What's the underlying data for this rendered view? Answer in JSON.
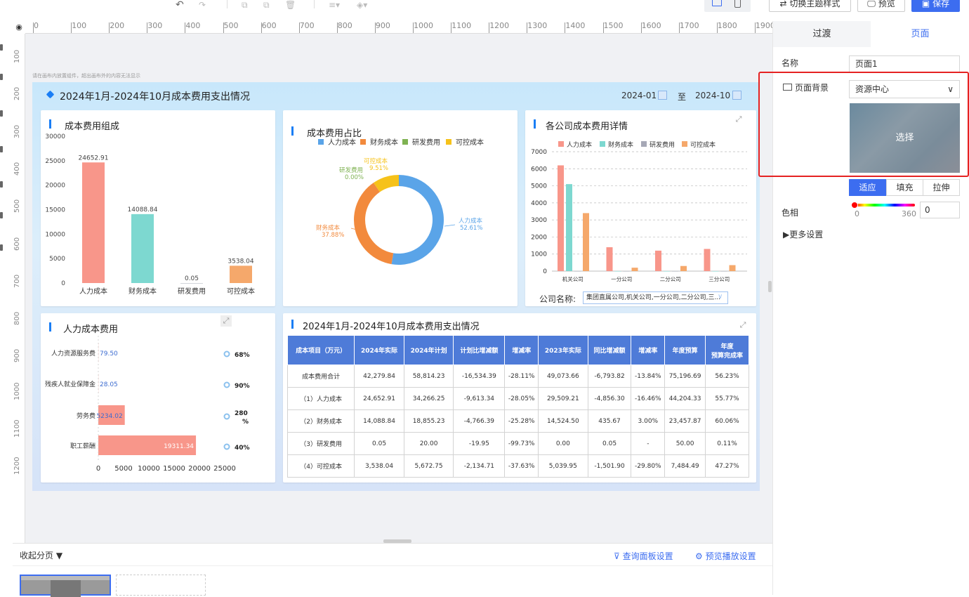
{
  "toolbar": {
    "switch_theme": "切换主题样式",
    "preview": "预览",
    "save": "保存"
  },
  "ruler": {
    "h": [
      "0",
      "100",
      "200",
      "300",
      "400",
      "500",
      "600",
      "700",
      "800",
      "900",
      "1000",
      "1100",
      "1200",
      "1300",
      "1400",
      "1500",
      "1600",
      "1700",
      "1800",
      "1900"
    ],
    "v": [
      "100",
      "200",
      "300",
      "400",
      "500",
      "600",
      "700",
      "800",
      "900",
      "1000",
      "1100",
      "1200"
    ]
  },
  "canvas": {
    "hint": "请在画布内放置组件，超出画布外的内容无法显示"
  },
  "dashboard": {
    "title": "2024年1月-2024年10月成本费用支出情况",
    "date_from": "2024-01",
    "date_sep": "至",
    "date_to": "2024-10",
    "company_label": "公司名称:",
    "company_value": "集团直属公司,机关公司,一分公司,二分公司,三..."
  },
  "chart_data": [
    {
      "type": "bar",
      "title": "成本费用组成",
      "categories": [
        "人力成本",
        "财务成本",
        "研发费用",
        "可控成本"
      ],
      "values": [
        24652.91,
        14088.84,
        0.05,
        3538.04
      ],
      "value_labels": [
        "24652.91",
        "14088.84",
        "0.05",
        "3538.04"
      ],
      "ylim": [
        0,
        30000
      ],
      "yticks": [
        "30000",
        "25000",
        "20000",
        "15000",
        "10000",
        "5000",
        "0"
      ],
      "colors": [
        "#f8968a",
        "#7dd8d0",
        "#a6a8b6",
        "#f5a86b"
      ]
    },
    {
      "type": "pie",
      "title": "成本费用占比",
      "legend": [
        "人力成本",
        "财务成本",
        "研发费用",
        "可控成本"
      ],
      "legend_placement": "top",
      "colors": [
        "#5aa4e8",
        "#f28a3d",
        "#7fb252",
        "#f6c21a"
      ],
      "values": [
        52.61,
        37.88,
        0.0,
        9.51
      ],
      "labels": [
        {
          "name": "人力成本",
          "pct": "52.61%"
        },
        {
          "name": "财务成本",
          "pct": "37.88%"
        },
        {
          "name": "研发费用",
          "pct": "0.00%"
        },
        {
          "name": "可控成本",
          "pct": "9.51%"
        }
      ]
    },
    {
      "type": "bar",
      "title": "各公司成本费用详情",
      "legend": [
        "人力成本",
        "财务成本",
        "研发费用",
        "可控成本"
      ],
      "colors": [
        "#f8968a",
        "#7dd8d0",
        "#a6a8b6",
        "#f5a86b"
      ],
      "categories": [
        "机关公司",
        "一分公司",
        "二分公司",
        "三分公司"
      ],
      "series": [
        {
          "name": "人力成本",
          "values": [
            6200,
            1400,
            1200,
            1300
          ]
        },
        {
          "name": "财务成本",
          "values": [
            5100,
            0,
            0,
            0
          ]
        },
        {
          "name": "研发费用",
          "values": [
            0,
            0,
            0,
            0
          ]
        },
        {
          "name": "可控成本",
          "values": [
            3400,
            200,
            300,
            350
          ]
        }
      ],
      "ylim": [
        0,
        7000
      ],
      "yticks": [
        "7000",
        "6000",
        "5000",
        "4000",
        "3000",
        "2000",
        "1000",
        "0"
      ],
      "grid": true
    },
    {
      "type": "bar",
      "title": "人力成本费用",
      "orientation": "horizontal",
      "categories": [
        "人力资源服务费",
        "残疾人就业保障金",
        "劳务费",
        "职工薪酬"
      ],
      "values": [
        79.5,
        28.05,
        5234.02,
        19311.34
      ],
      "value_labels": [
        "79.50",
        "28.05",
        "5234.02",
        "19311.34"
      ],
      "percents": [
        "68%",
        "90%",
        "280\n%",
        "40%"
      ],
      "xlim": [
        0,
        25000
      ],
      "xticks": [
        "0",
        "5000",
        "10000",
        "15000",
        "20000",
        "25000"
      ]
    }
  ],
  "table": {
    "title": "2024年1月-2024年10月成本费用支出情况",
    "headers": [
      "成本项目（万元）",
      "2024年实际",
      "2024年计划",
      "计划比增减额",
      "增减率",
      "2023年实际",
      "同比增减额",
      "增减率",
      "年度预算",
      "年度\n预算完成率"
    ],
    "rows": [
      [
        "成本费用合计",
        "42,279.84",
        "58,814.23",
        "-16,534.39",
        "-28.11%",
        "49,073.66",
        "-6,793.82",
        "-13.84%",
        "75,196.69",
        "56.23%"
      ],
      [
        "（1）人力成本",
        "24,652.91",
        "34,266.25",
        "-9,613.34",
        "-28.05%",
        "29,509.21",
        "-4,856.30",
        "-16.46%",
        "44,204.33",
        "55.77%"
      ],
      [
        "（2）财务成本",
        "14,088.84",
        "18,855.23",
        "-4,766.39",
        "-25.28%",
        "14,524.50",
        "435.67",
        "3.00%",
        "23,457.87",
        "60.06%"
      ],
      [
        "（3）研发费用",
        "0.05",
        "20.00",
        "-19.95",
        "-99.73%",
        "0.00",
        "0.05",
        "-",
        "50.00",
        "0.11%"
      ],
      [
        "（4）可控成本",
        "3,538.04",
        "5,672.75",
        "-2,134.71",
        "-37.63%",
        "5,039.95",
        "-1,501.90",
        "-29.80%",
        "7,484.49",
        "47.27%"
      ]
    ]
  },
  "bottom": {
    "collapse": "收起分页",
    "query_settings": "查询面板设置",
    "preview_settings": "预览播放设置"
  },
  "right_panel": {
    "tabs": [
      "过渡",
      "页面"
    ],
    "name_label": "名称",
    "name_value": "页面1",
    "bg_label": "页面背景",
    "bg_select": "资源中心",
    "choose": "选择",
    "fit_buttons": [
      "适应",
      "填充",
      "拉伸"
    ],
    "hue_label": "色相",
    "hue_min": "0",
    "hue_max": "360",
    "hue_value": "0",
    "more": "更多设置"
  },
  "colors": {
    "accent": "#3c6df0",
    "highlight": "#e52222"
  }
}
